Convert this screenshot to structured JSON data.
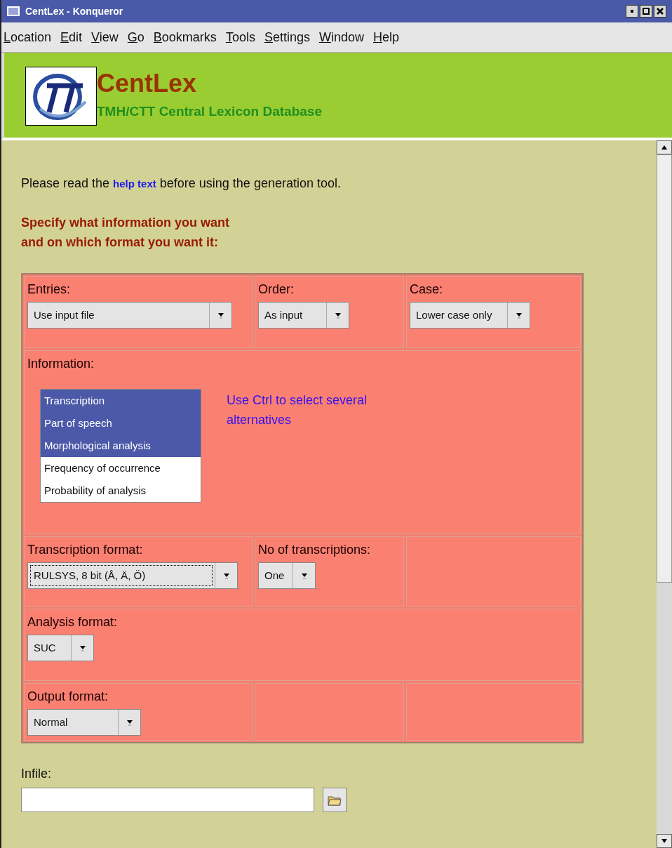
{
  "window": {
    "title": "CentLex - Konqueror"
  },
  "menu": [
    "Location",
    "Edit",
    "View",
    "Go",
    "Bookmarks",
    "Tools",
    "Settings",
    "Window",
    "Help"
  ],
  "header": {
    "title": "CentLex",
    "subtitle": "TMH/CTT Central Lexicon Database"
  },
  "intro": {
    "before": "Please read the ",
    "link": "help text",
    "after": " before using the generation tool."
  },
  "heading": [
    "Specify what information you want",
    "and on which format you want it:"
  ],
  "rows": [
    {
      "cells": [
        {
          "label": "Entries:",
          "select": {
            "value": "Use input file",
            "focused": false
          }
        },
        {
          "label": "Order:",
          "select": {
            "value": "As input",
            "focused": false
          }
        },
        {
          "label": "Case:",
          "select": {
            "value": "Lower case only",
            "focused": false
          }
        }
      ]
    },
    {
      "cells": [
        {
          "label": "Information:",
          "list": [
            {
              "label": "Transcription",
              "selected": true
            },
            {
              "label": "Part of speech",
              "selected": true
            },
            {
              "label": "Morphological analysis",
              "selected": true
            },
            {
              "label": "Frequency of occurrence",
              "selected": false
            },
            {
              "label": "Probability of analysis",
              "selected": false
            }
          ],
          "hint": "Use Ctrl to select several alternatives"
        }
      ]
    },
    {
      "cells": [
        {
          "label": "Transcription format:",
          "select": {
            "value": "RULSYS, 8 bit (Å, Ä, Ö)",
            "focused": true
          }
        },
        {
          "label": "No of transcriptions:",
          "select": {
            "value": "One",
            "focused": false
          }
        },
        {}
      ]
    },
    {
      "cells": [
        {
          "label": "Analysis format:",
          "select": {
            "value": "SUC",
            "focused": false
          }
        }
      ]
    },
    {
      "cells": [
        {
          "label": "Output format:",
          "select": {
            "value": "Normal",
            "focused": false
          }
        },
        {},
        {}
      ]
    }
  ],
  "infile": {
    "label": "Infile:"
  }
}
